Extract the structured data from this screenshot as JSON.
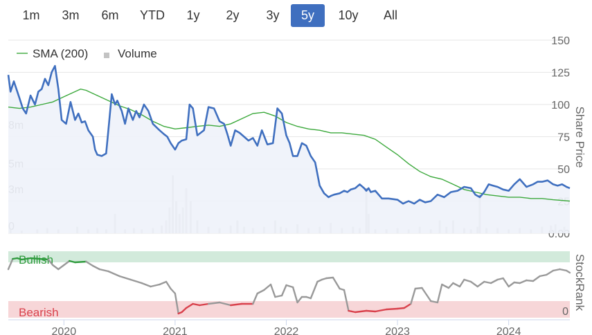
{
  "range_selector": {
    "buttons": [
      "1m",
      "3m",
      "6m",
      "YTD",
      "1y",
      "2y",
      "3y",
      "5y",
      "10y",
      "All"
    ],
    "active": "5y"
  },
  "colors": {
    "price": "#3f6fbf",
    "sma": "#3aa83a",
    "volume": "#c3c3c3",
    "bullish_band": "#d2eadb",
    "bearish_band": "#f7d6d8",
    "bullish_text": "#2e9b3d",
    "bearish_text": "#d9414c",
    "stockrank_neutral": "#999999",
    "stockrank_bull": "#2e9b3d",
    "stockrank_bear": "#d9414c",
    "active_button": "#3f6fbf"
  },
  "chart_data": [
    {
      "type": "line",
      "panel": "price",
      "legend": [
        "SMA (200)",
        "Volume"
      ],
      "y_right_label": "Share Price",
      "y_right_ticks": [
        0,
        25,
        50,
        75,
        100,
        125,
        150
      ],
      "y_right_tick_labels": [
        "0.00",
        "25",
        "50",
        "75",
        "100",
        "125",
        "150"
      ],
      "y_left_ticks": [
        0,
        3,
        5,
        8
      ],
      "y_left_tick_labels": [
        "0",
        "3m",
        "5m",
        "8m"
      ],
      "ylim": [
        0,
        150
      ],
      "volume_ylim": [
        0,
        15
      ],
      "x_tick_labels": [
        "2020",
        "2021",
        "2022",
        "2023",
        "2024"
      ],
      "x_ticks": [
        2020.0,
        2021.0,
        2022.0,
        2023.0,
        2024.0
      ],
      "xlim": [
        2019.5,
        2024.55
      ],
      "series": [
        {
          "name": "",
          "kind": "price",
          "x": [
            2019.5,
            2019.52,
            2019.55,
            2019.6,
            2019.63,
            2019.66,
            2019.7,
            2019.74,
            2019.77,
            2019.8,
            2019.83,
            2019.86,
            2019.89,
            2019.92,
            2019.95,
            2019.98,
            2020.02,
            2020.06,
            2020.1,
            2020.13,
            2020.16,
            2020.19,
            2020.22,
            2020.26,
            2020.28,
            2020.3,
            2020.34,
            2020.38,
            2020.4,
            2020.43,
            2020.46,
            2020.48,
            2020.52,
            2020.55,
            2020.58,
            2020.62,
            2020.65,
            2020.68,
            2020.72,
            2020.76,
            2020.8,
            2020.86,
            2020.9,
            2020.93,
            2020.96,
            2021.0,
            2021.03,
            2021.06,
            2021.1,
            2021.13,
            2021.16,
            2021.2,
            2021.23,
            2021.26,
            2021.3,
            2021.35,
            2021.4,
            2021.44,
            2021.47,
            2021.5,
            2021.54,
            2021.58,
            2021.62,
            2021.66,
            2021.7,
            2021.74,
            2021.78,
            2021.83,
            2021.88,
            2021.92,
            2021.96,
            2022.0,
            2022.03,
            2022.06,
            2022.1,
            2022.14,
            2022.18,
            2022.22,
            2022.26,
            2022.3,
            2022.34,
            2022.38,
            2022.4,
            2022.43,
            2022.48,
            2022.52,
            2022.55,
            2022.58,
            2022.62,
            2022.66,
            2022.7,
            2022.72,
            2022.74,
            2022.76,
            2022.8,
            2022.86,
            2022.92,
            2023.0,
            2023.05,
            2023.1,
            2023.15,
            2023.2,
            2023.25,
            2023.3,
            2023.36,
            2023.42,
            2023.48,
            2023.54,
            2023.6,
            2023.66,
            2023.7,
            2023.74,
            2023.78,
            2023.82,
            2023.86,
            2023.9,
            2023.95,
            2024.0,
            2024.05,
            2024.1,
            2024.16,
            2024.22,
            2024.26,
            2024.3,
            2024.35,
            2024.4,
            2024.44,
            2024.48,
            2024.52,
            2024.55
          ],
          "values": [
            123,
            110,
            118,
            105,
            97,
            93,
            107,
            100,
            110,
            112,
            120,
            115,
            125,
            130,
            112,
            88,
            85,
            102,
            88,
            93,
            86,
            87,
            80,
            75,
            65,
            61,
            60,
            62,
            80,
            108,
            100,
            103,
            95,
            85,
            97,
            88,
            95,
            90,
            100,
            95,
            85,
            80,
            77,
            75,
            70,
            65,
            70,
            72,
            73,
            100,
            97,
            76,
            78,
            80,
            98,
            97,
            87,
            85,
            77,
            68,
            80,
            78,
            75,
            72,
            74,
            68,
            80,
            69,
            70,
            97,
            93,
            76,
            70,
            60,
            60,
            70,
            68,
            60,
            55,
            37,
            31,
            28,
            29,
            30,
            31,
            33,
            32,
            34,
            35,
            38,
            35,
            33,
            35,
            32,
            33,
            27,
            27,
            26,
            23,
            25,
            23,
            26,
            24,
            25,
            30,
            28,
            32,
            33,
            36,
            35,
            30,
            28,
            32,
            38,
            37,
            36,
            34,
            33,
            38,
            42,
            36,
            38,
            40,
            40,
            41,
            38,
            37,
            38,
            36,
            35
          ],
          "note_y_values_mapping": "price panel"
        },
        {
          "name": "SMA (200)",
          "kind": "sma",
          "x": [
            2019.5,
            2019.6,
            2019.7,
            2019.8,
            2019.9,
            2020.0,
            2020.1,
            2020.15,
            2020.2,
            2020.3,
            2020.4,
            2020.5,
            2020.6,
            2020.7,
            2020.8,
            2020.9,
            2021.0,
            2021.1,
            2021.2,
            2021.3,
            2021.4,
            2021.5,
            2021.6,
            2021.7,
            2021.8,
            2021.9,
            2022.0,
            2022.1,
            2022.2,
            2022.3,
            2022.4,
            2022.5,
            2022.6,
            2022.7,
            2022.8,
            2022.9,
            2023.0,
            2023.1,
            2023.2,
            2023.3,
            2023.4,
            2023.5,
            2023.6,
            2023.7,
            2023.8,
            2023.9,
            2024.0,
            2024.1,
            2024.2,
            2024.3,
            2024.4,
            2024.55
          ],
          "values": [
            98,
            97,
            98,
            100,
            102,
            106,
            110,
            112,
            111,
            107,
            103,
            99,
            96,
            92,
            87,
            83,
            81,
            82,
            83,
            84,
            83,
            85,
            89,
            93,
            94,
            91,
            86,
            83,
            81,
            80,
            78,
            78,
            77,
            76,
            73,
            67,
            61,
            54,
            48,
            44,
            42,
            38,
            34,
            32,
            30,
            29,
            28,
            28,
            27,
            27,
            26,
            25
          ]
        },
        {
          "name": "Volume",
          "kind": "volume",
          "x": [
            2019.52,
            2019.62,
            2019.76,
            2019.85,
            2019.95,
            2020.12,
            2020.22,
            2020.3,
            2020.38,
            2020.46,
            2020.55,
            2020.63,
            2020.7,
            2020.8,
            2020.88,
            2020.92,
            2020.95,
            2020.98,
            2021.01,
            2021.04,
            2021.07,
            2021.1,
            2021.14,
            2021.2,
            2021.3,
            2021.4,
            2021.5,
            2021.56,
            2021.62,
            2021.7,
            2021.8,
            2021.9,
            2021.95,
            2022.0,
            2022.1,
            2022.2,
            2022.3,
            2022.4,
            2022.5,
            2022.6,
            2022.66,
            2022.72,
            2022.74,
            2022.8,
            2022.9,
            2023.0,
            2023.1,
            2023.2,
            2023.3,
            2023.38,
            2023.44,
            2023.5,
            2023.6,
            2023.66,
            2023.72,
            2023.74,
            2023.8,
            2023.9,
            2024.0,
            2024.1,
            2024.2,
            2024.3,
            2024.38,
            2024.42,
            2024.5
          ],
          "values": [
            0.3,
            0.2,
            0.3,
            0.4,
            0.3,
            0.5,
            0.3,
            0.4,
            0.3,
            1.5,
            0.3,
            0.4,
            0.3,
            0.4,
            0.6,
            1.0,
            2.0,
            4.5,
            2.5,
            1.5,
            2.0,
            3.5,
            2.5,
            1.0,
            0.5,
            0.4,
            0.6,
            1.0,
            0.5,
            0.4,
            0.5,
            1.0,
            0.5,
            0.4,
            0.7,
            0.4,
            0.5,
            0.8,
            0.4,
            0.5,
            0.4,
            3.5,
            1.5,
            0.3,
            0.3,
            0.4,
            0.3,
            0.5,
            0.3,
            1.0,
            0.5,
            1.0,
            0.4,
            0.3,
            0.5,
            3.0,
            0.4,
            0.4,
            0.3,
            0.4,
            0.3,
            0.5,
            0.6,
            0.7,
            0.5
          ]
        }
      ]
    },
    {
      "type": "line",
      "panel": "stockrank",
      "y_right_label": "StockRank",
      "y_right_ticks": [
        0
      ],
      "y_right_tick_labels": [
        "0"
      ],
      "bands": [
        {
          "label": "Bullish",
          "from": 80,
          "to": 100
        },
        {
          "label": "Bearish",
          "from": 0,
          "to": 20
        }
      ],
      "ylim": [
        0,
        100
      ],
      "series": [
        {
          "name": "",
          "x": [
            2019.5,
            2019.54,
            2019.58,
            2019.62,
            2019.7,
            2019.78,
            2019.86,
            2019.9,
            2019.95,
            2020.0,
            2020.05,
            2020.1,
            2020.2,
            2020.26,
            2020.32,
            2020.4,
            2020.5,
            2020.6,
            2020.7,
            2020.78,
            2020.86,
            2020.92,
            2020.96,
            2021.0,
            2021.03,
            2021.06,
            2021.1,
            2021.16,
            2021.22,
            2021.3,
            2021.4,
            2021.5,
            2021.6,
            2021.7,
            2021.74,
            2021.8,
            2021.86,
            2021.9,
            2021.96,
            2022.0,
            2022.06,
            2022.1,
            2022.14,
            2022.18,
            2022.22,
            2022.28,
            2022.32,
            2022.36,
            2022.42,
            2022.48,
            2022.52,
            2022.56,
            2022.62,
            2022.72,
            2022.8,
            2022.9,
            2023.0,
            2023.06,
            2023.12,
            2023.16,
            2023.22,
            2023.3,
            2023.36,
            2023.4,
            2023.46,
            2023.5,
            2023.56,
            2023.6,
            2023.66,
            2023.72,
            2023.78,
            2023.84,
            2023.9,
            2023.95,
            2024.0,
            2024.05,
            2024.1,
            2024.16,
            2024.22,
            2024.28,
            2024.34,
            2024.4,
            2024.46,
            2024.52,
            2024.55
          ],
          "values": [
            70,
            85,
            86,
            84,
            86,
            85,
            84,
            76,
            70,
            76,
            82,
            80,
            81,
            75,
            70,
            67,
            60,
            55,
            50,
            45,
            48,
            52,
            42,
            35,
            6,
            8,
            14,
            20,
            18,
            20,
            22,
            18,
            20,
            20,
            35,
            40,
            48,
            30,
            32,
            47,
            44,
            22,
            30,
            30,
            28,
            52,
            55,
            57,
            58,
            42,
            40,
            10,
            8,
            10,
            9,
            12,
            13,
            14,
            20,
            42,
            43,
            24,
            22,
            48,
            43,
            50,
            45,
            55,
            52,
            45,
            52,
            50,
            55,
            57,
            45,
            51,
            50,
            54,
            53,
            60,
            62,
            68,
            70,
            68,
            65
          ],
          "bull_threshold": 80,
          "bear_threshold": 20
        }
      ]
    }
  ]
}
